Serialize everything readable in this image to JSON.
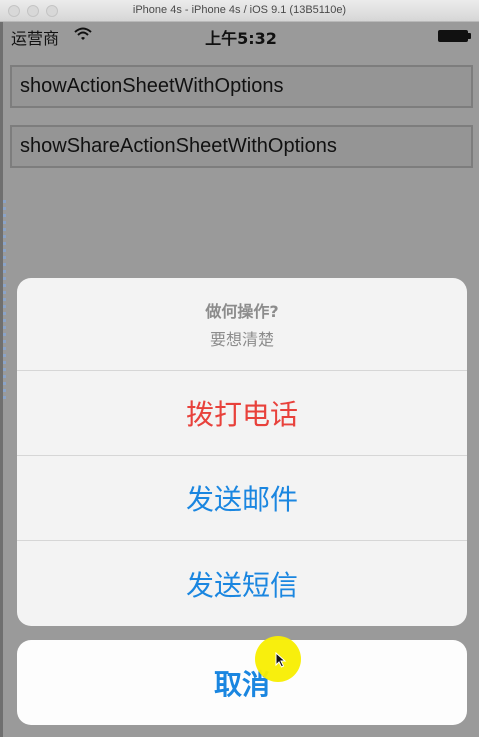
{
  "window": {
    "title": "iPhone 4s - iPhone 4s / iOS 9.1 (13B5110e)"
  },
  "status_bar": {
    "carrier": "运营商",
    "time": "上午5:32"
  },
  "buttons": {
    "action_sheet": "showActionSheetWithOptions",
    "share_action_sheet": "showShareActionSheetWithOptions"
  },
  "action_sheet": {
    "title": "做何操作?",
    "message": "要想清楚",
    "options": [
      {
        "label": "拨打电话",
        "style": "destructive"
      },
      {
        "label": "发送邮件",
        "style": "default"
      },
      {
        "label": "发送短信",
        "style": "default"
      }
    ],
    "cancel_label": "取消"
  },
  "colors": {
    "accent": "#1a86e0",
    "destructive": "#e8413b",
    "touch_indicator": "#f8ee00"
  }
}
